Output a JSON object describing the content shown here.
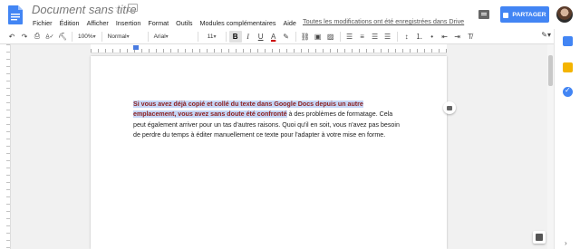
{
  "app": {
    "title": "Document sans titre",
    "saved_status": "Toutes les modifications ont été enregistrées dans Drive",
    "share_label": "PARTAGER"
  },
  "menu": [
    "Fichier",
    "Édition",
    "Afficher",
    "Insertion",
    "Format",
    "Outils",
    "Modules complémentaires",
    "Aide"
  ],
  "toolbar": {
    "zoom": "100%",
    "style": "Normal",
    "font": "Arial",
    "font_size": "11",
    "bold": "B",
    "italic": "I",
    "underline": "U",
    "text_color": "A"
  },
  "document": {
    "highlighted_text": "Si vous avez déjà copié et collé du texte dans Google Docs depuis un autre emplacement, vous avez sans doute été confronté",
    "body_text": " à des problèmes de formatage. Cela peut également arriver pour un tas d'autres raisons. Quoi qu'il en soit, vous n'avez pas besoin de perdre du temps à éditer manuellement ce texte pour l'adapter à votre mise en forme."
  },
  "icons": {
    "doc": "docs-logo-icon",
    "star": "star-icon",
    "folder": "folder-icon",
    "comments": "comments-icon",
    "lock": "lock-icon",
    "undo": "undo-icon",
    "redo": "redo-icon",
    "print": "print-icon",
    "spellcheck": "spellcheck-icon",
    "paint_format": "paint-format-icon"
  },
  "colors": {
    "accent": "#4285f4",
    "highlight_bg": "#c6d6f6",
    "highlight_text": "#8b1f1f",
    "keep": "#f4b400"
  }
}
